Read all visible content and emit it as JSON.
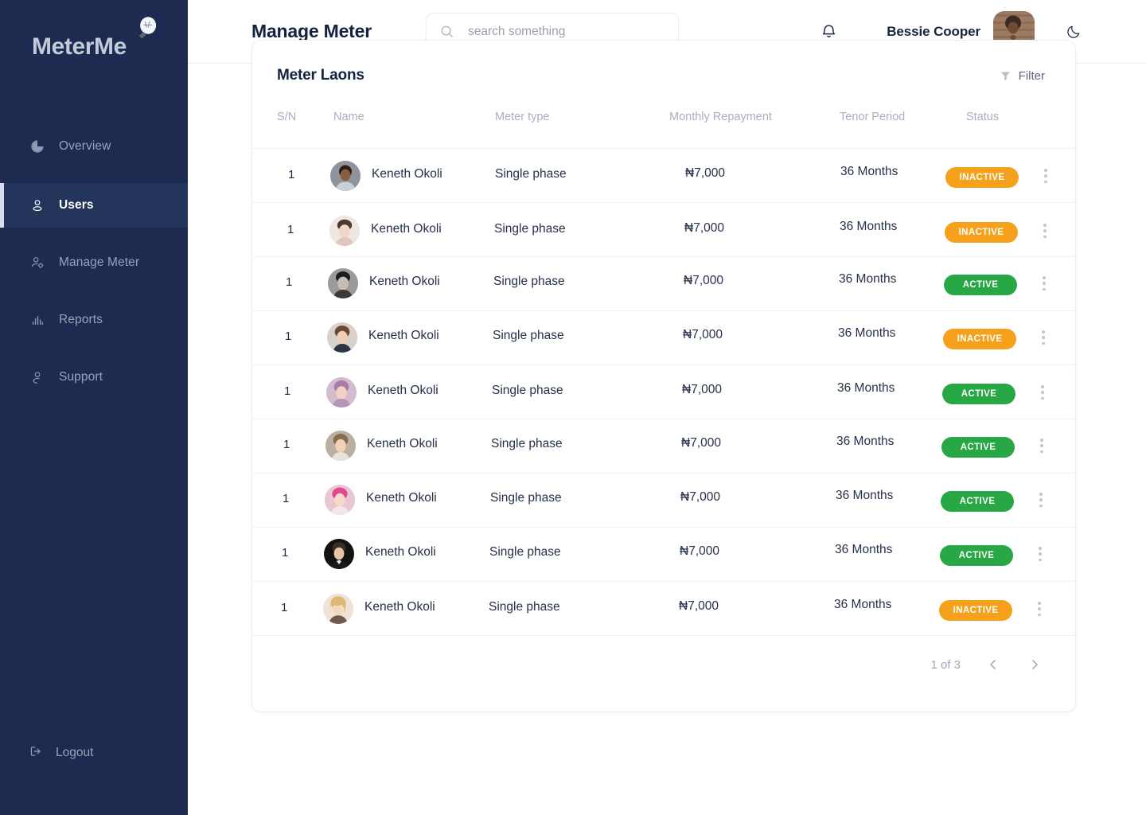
{
  "brand": {
    "name": "MeterMe",
    "icon": "lightbulb-icon"
  },
  "sidebar": {
    "items": [
      {
        "label": "Overview",
        "icon": "pie-chart-icon",
        "active": false
      },
      {
        "label": "Users",
        "icon": "user-icon",
        "active": true
      },
      {
        "label": "Manage Meter",
        "icon": "user-cog-icon",
        "active": false
      },
      {
        "label": "Reports",
        "icon": "bar-chart-icon",
        "active": false
      },
      {
        "label": "Support",
        "icon": "support-icon",
        "active": false
      }
    ],
    "logout": {
      "label": "Logout",
      "icon": "logout-icon"
    }
  },
  "header": {
    "tab_label": "Manage Meter",
    "search": {
      "value": "",
      "placeholder": "search something",
      "icon": "search-icon"
    },
    "notifications_icon": "bell-icon",
    "user_name": "Bessie Cooper",
    "avatar_alt": "Bessie Cooper avatar",
    "theme_toggle_icon": "moon-icon"
  },
  "card": {
    "title": "Meter Laons",
    "filter": {
      "label": "Filter",
      "icon": "filter-icon"
    },
    "columns": [
      "S/N",
      "Name",
      "Meter type",
      "Monthly Repayment",
      "Tenor Period",
      "Status"
    ],
    "rows": [
      {
        "sn": "1",
        "name": "Keneth Okoli",
        "meter_type": "Single phase",
        "monthly_repayment": "₦7,000",
        "tenor_period": "36 Months",
        "status": "INACTIVE"
      },
      {
        "sn": "1",
        "name": "Keneth Okoli",
        "meter_type": "Single phase",
        "monthly_repayment": "₦7,000",
        "tenor_period": "36 Months",
        "status": "INACTIVE"
      },
      {
        "sn": "1",
        "name": "Keneth Okoli",
        "meter_type": "Single phase",
        "monthly_repayment": "₦7,000",
        "tenor_period": "36 Months",
        "status": "ACTIVE"
      },
      {
        "sn": "1",
        "name": "Keneth Okoli",
        "meter_type": "Single phase",
        "monthly_repayment": "₦7,000",
        "tenor_period": "36 Months",
        "status": "INACTIVE"
      },
      {
        "sn": "1",
        "name": "Keneth Okoli",
        "meter_type": "Single phase",
        "monthly_repayment": "₦7,000",
        "tenor_period": "36 Months",
        "status": "ACTIVE"
      },
      {
        "sn": "1",
        "name": "Keneth Okoli",
        "meter_type": "Single phase",
        "monthly_repayment": "₦7,000",
        "tenor_period": "36 Months",
        "status": "ACTIVE"
      },
      {
        "sn": "1",
        "name": "Keneth Okoli",
        "meter_type": "Single phase",
        "monthly_repayment": "₦7,000",
        "tenor_period": "36 Months",
        "status": "ACTIVE"
      },
      {
        "sn": "1",
        "name": "Keneth Okoli",
        "meter_type": "Single phase",
        "monthly_repayment": "₦7,000",
        "tenor_period": "36 Months",
        "status": "ACTIVE"
      },
      {
        "sn": "1",
        "name": "Keneth Okoli",
        "meter_type": "Single phase",
        "monthly_repayment": "₦7,000",
        "tenor_period": "36 Months",
        "status": "INACTIVE"
      }
    ],
    "row_menu_icon": "kebab-menu-icon",
    "pagination": {
      "label": "1 of 3",
      "prev_icon": "chevron-left-icon",
      "next_icon": "chevron-right-icon"
    }
  },
  "colors": {
    "sidebar_bg": "#1c2b4f",
    "sidebar_active_bg": "#24355c",
    "sidebar_accent": "#d8ddf2",
    "status_active": "#28a745",
    "status_inactive": "#f5a11b",
    "text_dark": "#13233f",
    "text_muted": "#a9aec0"
  }
}
